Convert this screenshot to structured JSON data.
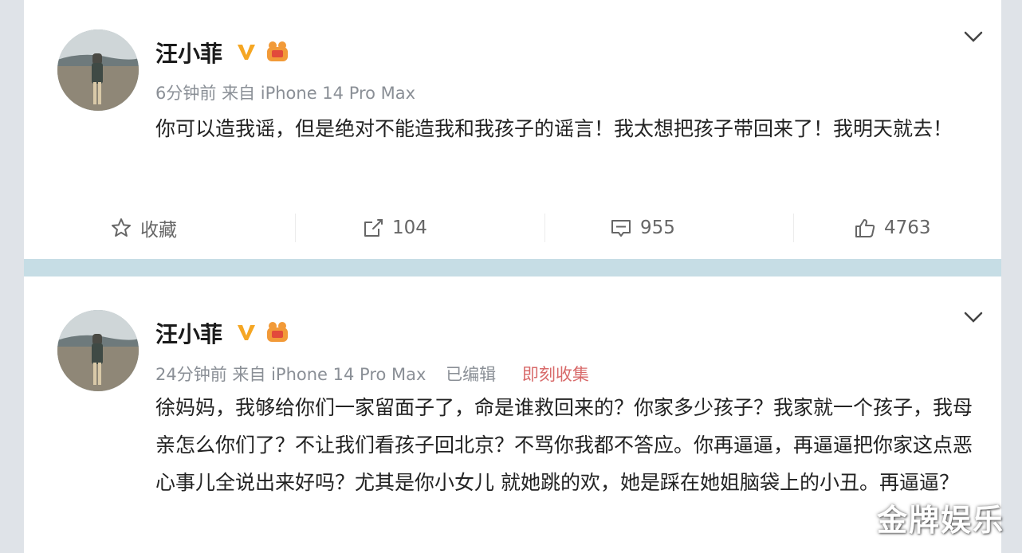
{
  "posts": [
    {
      "author": "汪小菲",
      "time": "6分钟前",
      "source": "来自 iPhone 14 Pro Max",
      "content": "你可以造我谣，但是绝对不能造我和我孩子的谣言！我太想把孩子带回来了！我明天就去！",
      "actions": {
        "favorite_label": "收藏",
        "share_count": "104",
        "comment_count": "955",
        "like_count": "4763"
      }
    },
    {
      "author": "汪小菲",
      "time": "24分钟前",
      "source": "来自 iPhone 14 Pro Max",
      "edited_label": "已编辑",
      "collect_label": "即刻收集",
      "content": "徐妈妈，我够给你们一家留面子了，命是谁救回来的？你家多少孩子？我家就一个孩子，我母亲怎么你们了？不让我们看孩子回北京？不骂你我都不答应。你再逼逼，再逼逼把你家这点恶心事儿全说出来好吗？尤其是你小女儿 就她跳的欢，她是踩在她姐脑袋上的小丑。再逼逼？"
    }
  ],
  "watermark": "金牌娱乐",
  "colors": {
    "background": "#dfe3e8",
    "divider": "#c6dde5",
    "meta_text": "#8a8f96",
    "vip_badge": "#f5a623",
    "collect_text": "#d86a6a"
  }
}
